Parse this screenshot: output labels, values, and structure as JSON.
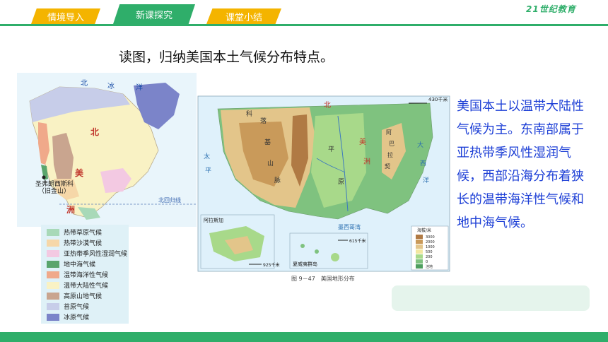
{
  "tabs": [
    {
      "label": "情境导入"
    },
    {
      "label": "新课探究"
    },
    {
      "label": "课堂小结"
    }
  ],
  "logo": {
    "text": "21世纪教育"
  },
  "heading": "读图，归纳美国本土气候分布特点。",
  "left_map": {
    "labels": {
      "ocean_north_1": "北",
      "ocean_north_2": "冰",
      "ocean_north_3": "洋",
      "continent_1": "北",
      "continent_2": "美",
      "continent_3": "洲",
      "city": "圣弗朗西斯科",
      "city_alt": "（旧金山）",
      "tropic": "北回归线"
    }
  },
  "legend": [
    {
      "label": "热带草原气候",
      "color": "#a8d9b8"
    },
    {
      "label": "热带沙漠气候",
      "color": "#f6d7a8"
    },
    {
      "label": "亚热带季风性湿润气候",
      "color": "#f3c9e2"
    },
    {
      "label": "地中海气候",
      "color": "#5aa56c"
    },
    {
      "label": "温带海洋性气候",
      "color": "#f0a98a"
    },
    {
      "label": "温带大陆性气候",
      "color": "#f9f2c4"
    },
    {
      "label": "高原山地气候",
      "color": "#c9a58f"
    },
    {
      "label": "苔原气候",
      "color": "#c7cde9"
    },
    {
      "label": "冰原气候",
      "color": "#7b84c9"
    }
  ],
  "right_map": {
    "scale_main": "430千米",
    "scale_alaska": "925千米",
    "scale_hawaii": "615千米",
    "inset_alaska": "阿拉斯加",
    "inset_hawaii": "夏威夷群岛",
    "altitude_title": "海拔/米",
    "altitude_levels": [
      "3000",
      "2000",
      "1000",
      "500",
      "200",
      "0",
      "洼地"
    ],
    "caption": "图 9－47　美国地形分布",
    "labels": {
      "rocky_1": "科",
      "rocky_2": "落",
      "rocky_3": "基",
      "rocky_4": "山",
      "rocky_5": "脉",
      "plains_1": "平",
      "plains_2": "原",
      "mts_1": "阿",
      "mts_2": "巴",
      "mts_3": "拉",
      "mts_4": "契",
      "north_1": "北",
      "north_2": "美",
      "north_3": "洲",
      "west_1": "太",
      "west_2": "平",
      "east_1": "大",
      "east_2": "西",
      "east_3": "洋",
      "gulf": "墨西哥湾"
    }
  },
  "answer": "美国本土以温带大陆性气候为主。东南部属于亚热带季风性湿润气候，西部沿海分布着狭长的温带海洋性气候和地中海气候。",
  "colors": {
    "accent_green": "#2fae6a",
    "accent_yellow": "#f4b400",
    "answer_blue": "#1d3fd6"
  }
}
